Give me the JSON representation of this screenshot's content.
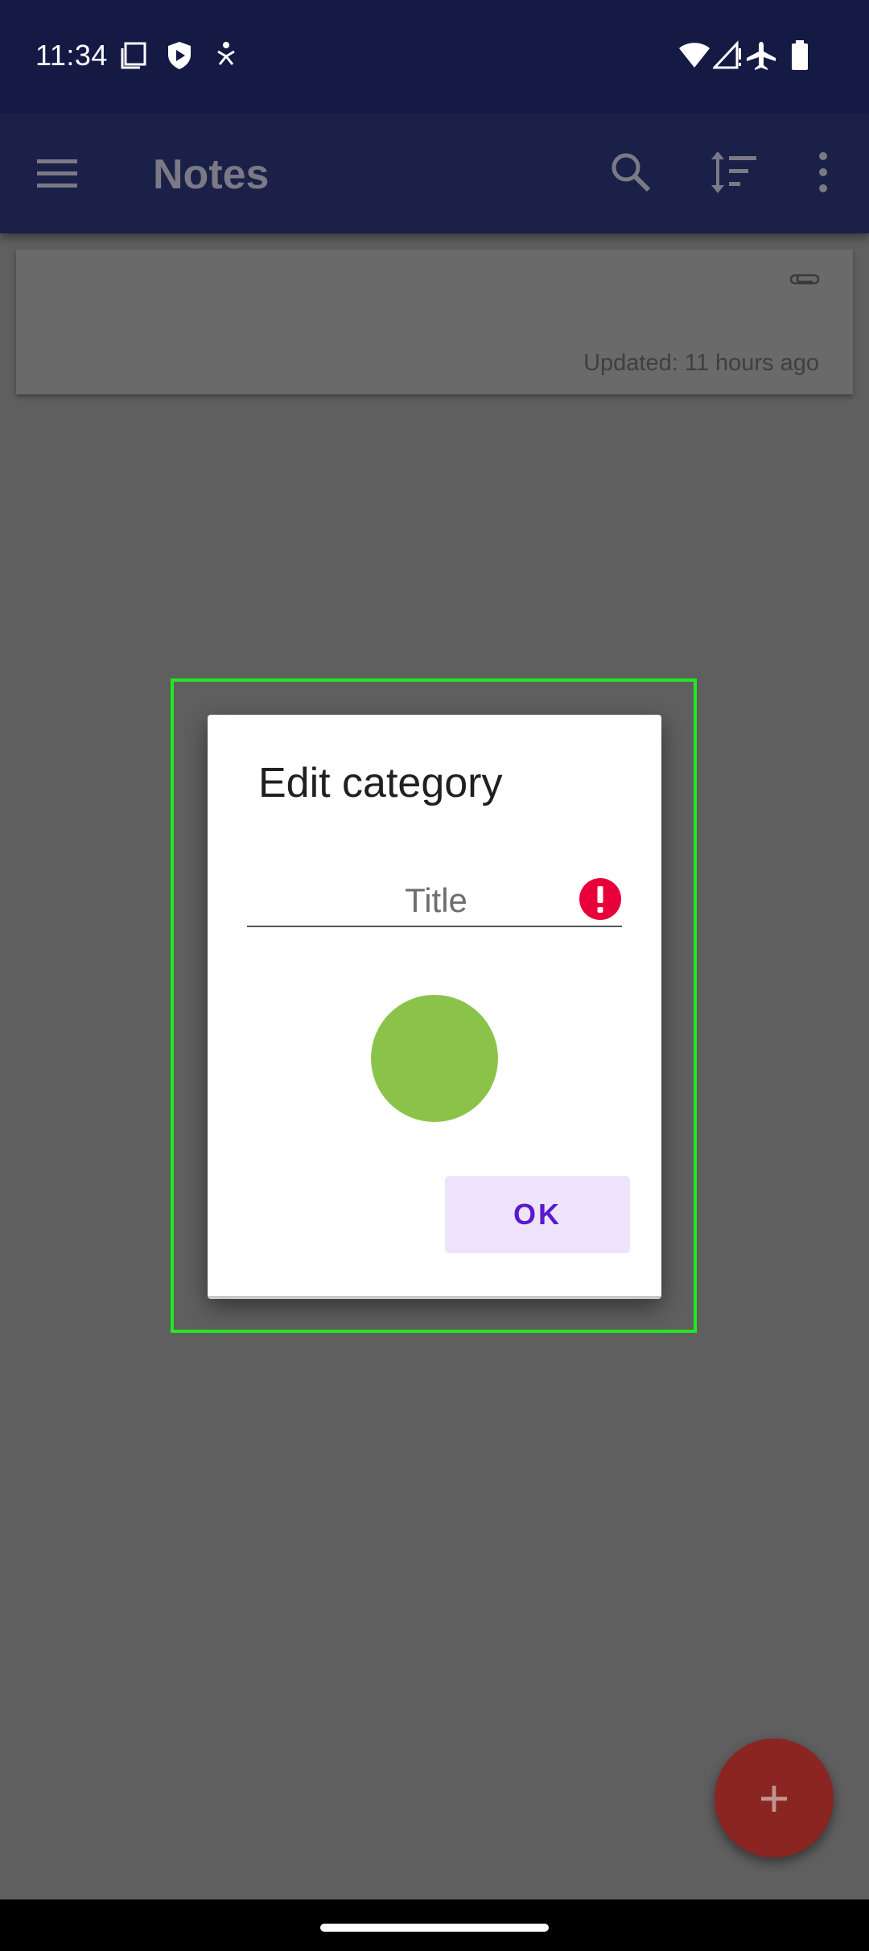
{
  "status_bar": {
    "time": "11:34",
    "left_icons": [
      "screenshot-icon",
      "shield-icon",
      "accessibility-icon"
    ],
    "right_icons": [
      "wifi-icon",
      "signal-icon",
      "airplane-icon",
      "battery-icon"
    ]
  },
  "app_bar": {
    "title": "Notes",
    "icons": [
      "menu-icon",
      "search-icon",
      "sort-icon",
      "more-icon"
    ]
  },
  "note_card": {
    "updated_text": "Updated: 11 hours ago",
    "icon": "paperclip-icon"
  },
  "dialog": {
    "title": "Edit category",
    "title_field": {
      "placeholder": "Title",
      "value": "",
      "error_icon": "error-icon"
    },
    "selected_color": "#8bc34a",
    "ok_label": "OK"
  },
  "fab": {
    "label": "+",
    "color": "#8a2522"
  },
  "colors": {
    "status_bar": "#141a44",
    "app_bar": "#1b2048",
    "accent": "#5a18d0",
    "error": "#e8003a",
    "highlight": "#22e822"
  }
}
